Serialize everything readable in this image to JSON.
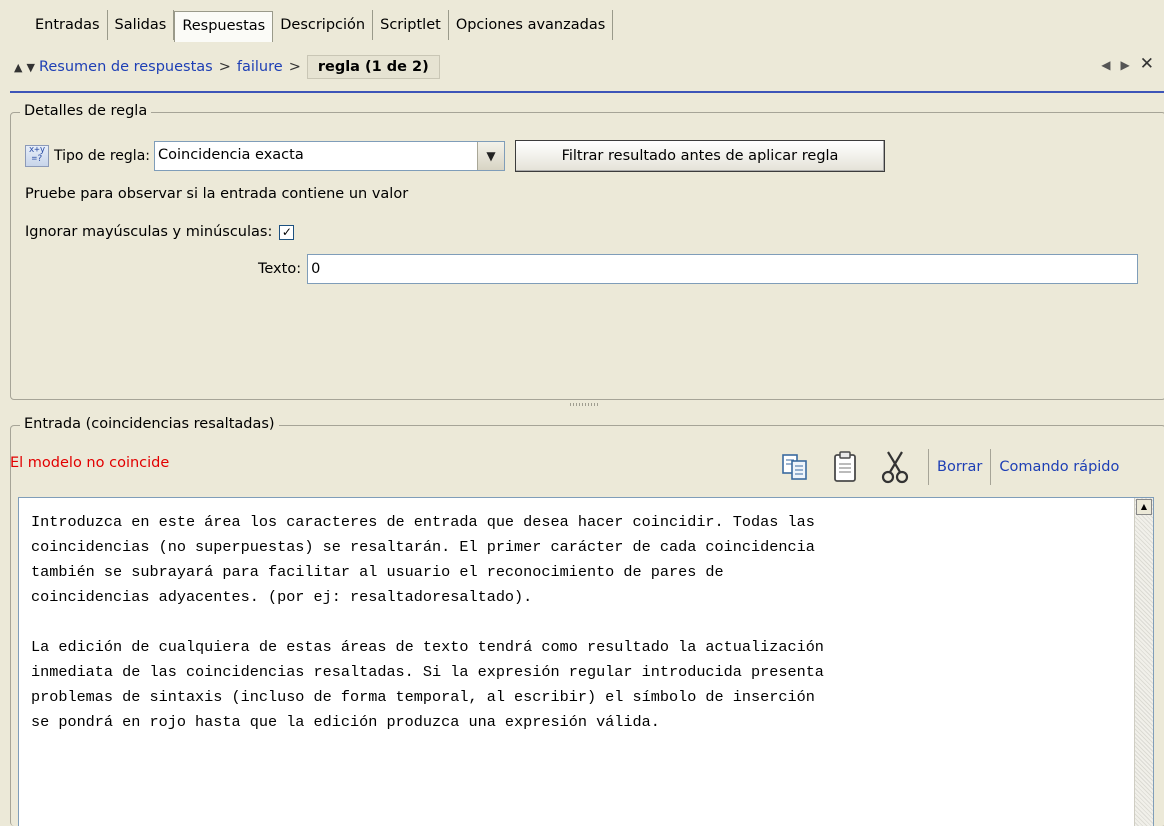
{
  "tabs": [
    "Entradas",
    "Salidas",
    "Respuestas",
    "Descripción",
    "Scriptlet",
    "Opciones avanzadas"
  ],
  "active_tab": "Respuestas",
  "breadcrumb": {
    "link1": "Resumen de respuestas",
    "link2": "failure",
    "separator": ">",
    "current": "regla (1 de 2)"
  },
  "rule_details": {
    "group_title": "Detalles de regla",
    "rule_type_label": "Tipo de regla:",
    "rule_type_value": "Coincidencia exacta",
    "filter_button": "Filtrar resultado antes de aplicar regla",
    "description": "Pruebe para observar si la entrada contiene un valor",
    "ignore_case_label": "Ignorar mayúsculas y minúsculas:",
    "ignore_case_checked": true,
    "text_label": "Texto:",
    "text_value": "0"
  },
  "input_section": {
    "group_title": "Entrada (coincidencias resaltadas)",
    "status": "El modelo no coincide",
    "clear_link": "Borrar",
    "quick_command_link": "Comando rápido",
    "body_text": "Introduzca en este área los caracteres de entrada que desea hacer coincidir. Todas las\ncoincidencias (no superpuestas) se resaltarán. El primer carácter de cada coincidencia\ntambién se subrayará para facilitar al usuario el reconocimiento de pares de\ncoincidencias adyacentes. (por ej: resaltadoresaltado).\n\nLa edición de cualquiera de estas áreas de texto tendrá como resultado la actualización\ninmediata de las coincidencias resaltadas. Si la expresión regular introducida presenta\nproblemas de sintaxis (incluso de forma temporal, al escribir) el símbolo de inserción\nse pondrá en rojo hasta que la edición produzca una expresión válida."
  },
  "icons": [
    "copy-icon",
    "paste-icon",
    "cut-icon",
    "formula-icon",
    "dropdown-arrow-icon",
    "nav-up-icon",
    "nav-down-icon",
    "nav-left-icon",
    "nav-right-icon",
    "close-icon"
  ],
  "colors": {
    "link": "#1e3fb5",
    "error": "#e20000",
    "accent_rule": "#3d55b8",
    "background": "#ece9d8"
  }
}
